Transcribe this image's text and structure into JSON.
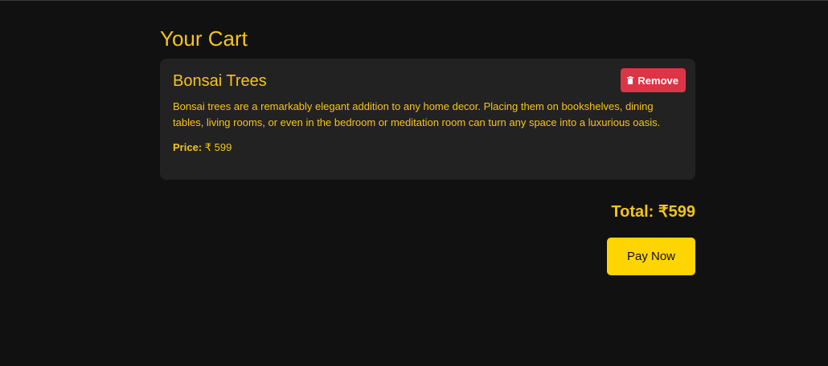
{
  "page": {
    "title": "Your Cart"
  },
  "cart": {
    "items": [
      {
        "name": "Bonsai Trees",
        "description": "Bonsai trees are a remarkably elegant addition to any home decor. Placing them on bookshelves, dining tables, living rooms, or even in the bedroom or meditation room can turn any space into a luxurious oasis.",
        "price_label": "Price:",
        "price_value": "₹ 599",
        "remove_label": "Remove",
        "remove_icon": "trash-icon"
      }
    ]
  },
  "summary": {
    "total_text": "Total: ₹599",
    "pay_label": "Pay Now"
  },
  "colors": {
    "background": "#111111",
    "card": "#222222",
    "accent": "#f5c518",
    "pay_button": "#ffd500",
    "remove_button": "#dc3545"
  }
}
